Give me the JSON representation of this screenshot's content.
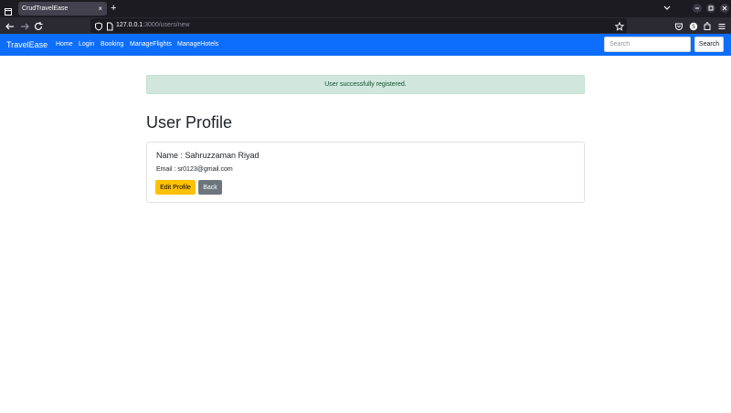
{
  "browser": {
    "tab_title": "CrudTravelEase",
    "tab_close": "×",
    "new_tab": "+",
    "url_host": "127.0.0.1",
    "url_path": ":3000/users/new",
    "icons": [
      "window-icon",
      "back-arrow-icon",
      "forward-arrow-icon",
      "reload-icon",
      "shield-icon",
      "page-icon",
      "bookmark-star-icon",
      "pocket-icon",
      "profile-icon",
      "extensions-icon",
      "menu-icon",
      "minimize-icon",
      "maximize-icon",
      "close-icon"
    ]
  },
  "navbar": {
    "brand": "TravelEase",
    "links": [
      "Home",
      "Login",
      "Booking",
      "ManageFlights",
      "ManageHotels"
    ],
    "search_placeholder": "Search",
    "search_button": "Search",
    "color": "#0d6efd"
  },
  "alert": {
    "message": "User successfully registered.",
    "color": "#d1e7dd"
  },
  "profile": {
    "heading": "User Profile",
    "name_line": "Name : Sahruzzaman Riyad",
    "email_line": "Email : sr0123@gmail.com",
    "edit_button": "Edit Profile",
    "back_button": "Back",
    "edit_color": "#ffc107",
    "back_color": "#6c757d"
  }
}
